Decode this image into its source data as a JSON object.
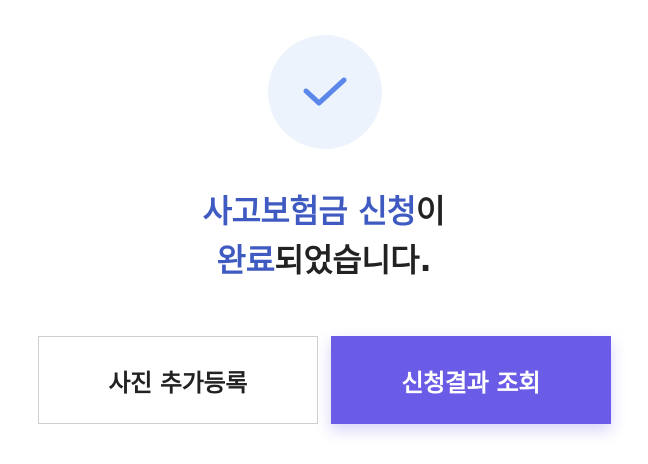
{
  "status_icon": "check-icon",
  "colors": {
    "accent_text": "#3f5bc2",
    "icon_check": "#5b86ea",
    "icon_bg": "#edf3fc",
    "primary_button": "#6b5ce7"
  },
  "message": {
    "line1_accent": "사고보험금 신청",
    "line1_rest": "이",
    "line2_accent": "완료",
    "line2_rest": "되었습니다."
  },
  "buttons": {
    "add_photo": "사진 추가등록",
    "view_result": "신청결과 조회"
  }
}
